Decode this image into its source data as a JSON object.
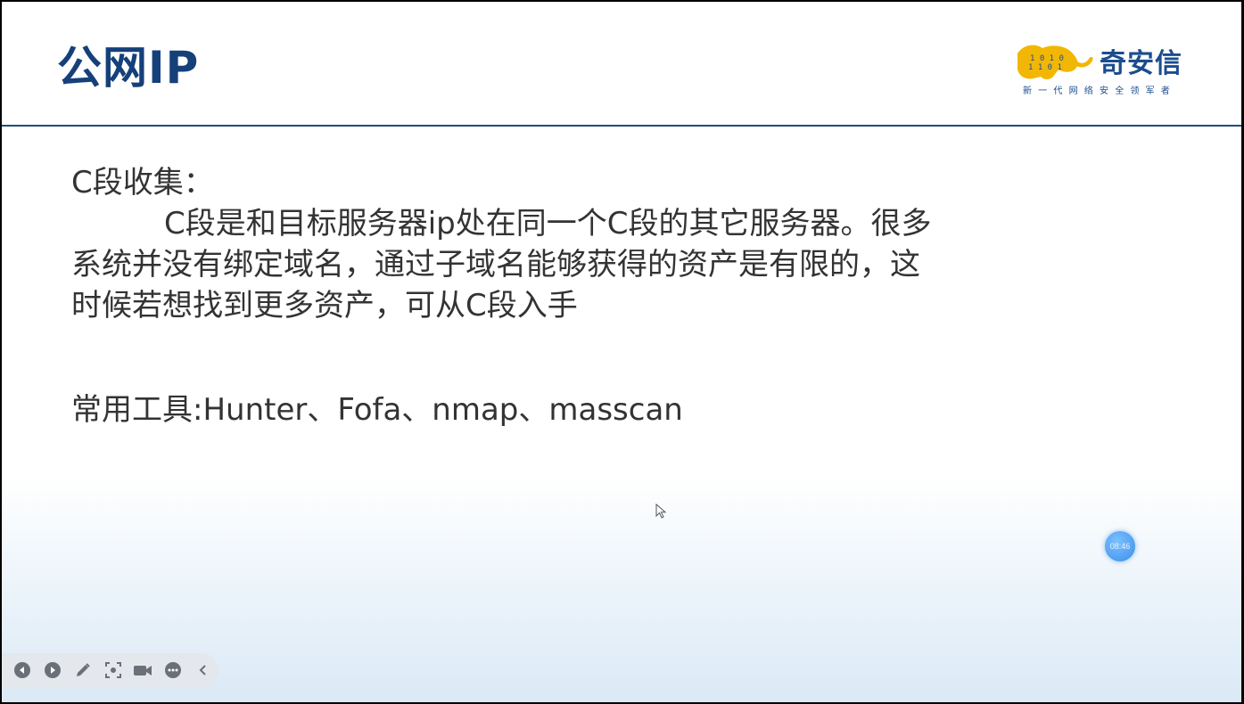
{
  "header": {
    "title": "公网IP",
    "logo_name": "奇安信",
    "logo_slogan": "新一代网络安全领军者"
  },
  "content": {
    "heading": "C段收集：",
    "paragraph_line1": "C段是和目标服务器ip处在同一个C段的其它服务器。很多",
    "paragraph_line2": "系统并没有绑定域名，通过子域名能够获得的资产是有限的，这",
    "paragraph_line3": "时候若想找到更多资产，可从C段入手",
    "tools": "常用工具:Hunter、Fofa、nmap、masscan"
  },
  "timer": {
    "label": "08:46"
  },
  "toolbar": {
    "icons": [
      "prev-icon",
      "play-icon",
      "pen-icon",
      "screenshot-icon",
      "camera-icon",
      "more-icon",
      "collapse-icon"
    ]
  },
  "colors": {
    "title": "#15407a",
    "header_rule": "#1f4e79",
    "logo_yellow": "#f2b705",
    "logo_blue": "#1a4d8f",
    "timer": "#3b8fe8",
    "toolbar_bg": "#e4e7ec"
  }
}
